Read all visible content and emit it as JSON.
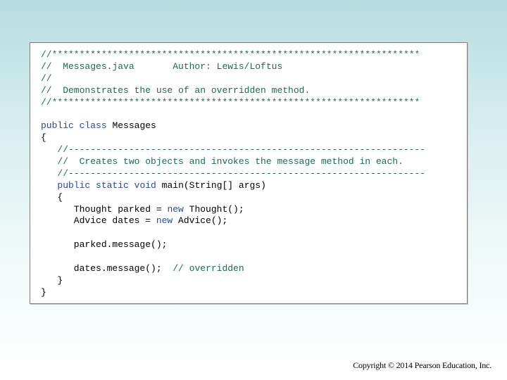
{
  "code": {
    "header_rule": "//*******************************************************************",
    "header_file": "//  Messages.java       Author: Lewis/Loftus",
    "header_blank": "//",
    "header_desc": "//  Demonstrates the use of an overridden method.",
    "header_rule_end": "//*******************************************************************",
    "kw_public": "public",
    "kw_class": "class",
    "class_name": " Messages",
    "open_brace_class": "{",
    "method_rule": "   //-----------------------------------------------------------------",
    "method_desc": "   //  Creates two objects and invokes the message method in each.",
    "method_rule_end": "   //-----------------------------------------------------------------",
    "kw_public_2": "public",
    "kw_static": "static",
    "kw_void": "void",
    "main_sig": " main(String[] args)",
    "open_brace_method": "   {",
    "line_thought_a": "      Thought parked = ",
    "kw_new_1": "new",
    "line_thought_b": " Thought();",
    "line_advice_a": "      Advice dates = ",
    "kw_new_2": "new",
    "line_advice_b": " Advice();",
    "line_parked_msg": "      parked.message();",
    "line_dates_msg": "      dates.message();  ",
    "comment_overridden": "// overridden",
    "close_brace_method": "   }",
    "close_brace_class": "}"
  },
  "footer": {
    "copyright": "Copyright © 2014 Pearson Education, Inc."
  },
  "colors": {
    "comment": "#1a6b52",
    "keyword": "#2647a8",
    "text": "#000000"
  }
}
